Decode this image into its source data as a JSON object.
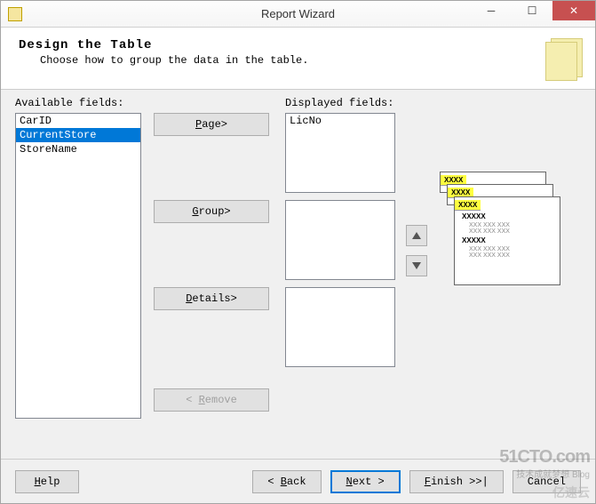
{
  "window": {
    "title": "Report Wizard"
  },
  "header": {
    "title": "Design the Table",
    "subtitle": "Choose how to group the data in the table."
  },
  "labels": {
    "available": "Available fields:",
    "displayed": "Displayed fields:"
  },
  "available_fields": [
    {
      "name": "CarID",
      "selected": false
    },
    {
      "name": "CurrentStore",
      "selected": true
    },
    {
      "name": "StoreName",
      "selected": false
    }
  ],
  "displayed": {
    "page": [
      "LicNo"
    ],
    "group": [],
    "details": []
  },
  "buttons": {
    "page": "Page>",
    "group": "Group>",
    "details": "Details>",
    "remove": "< Remove",
    "help": "Help",
    "back": "< Back",
    "next": "Next >",
    "finish": "Finish >>|",
    "cancel": "Cancel"
  },
  "preview": {
    "header": "XXXX",
    "group": "XXXXX",
    "row": "XXX XXX XXX"
  },
  "watermark": {
    "main": "51CTO.com",
    "sub": "技术成就梦想 Blog",
    "logo": "亿速云"
  }
}
